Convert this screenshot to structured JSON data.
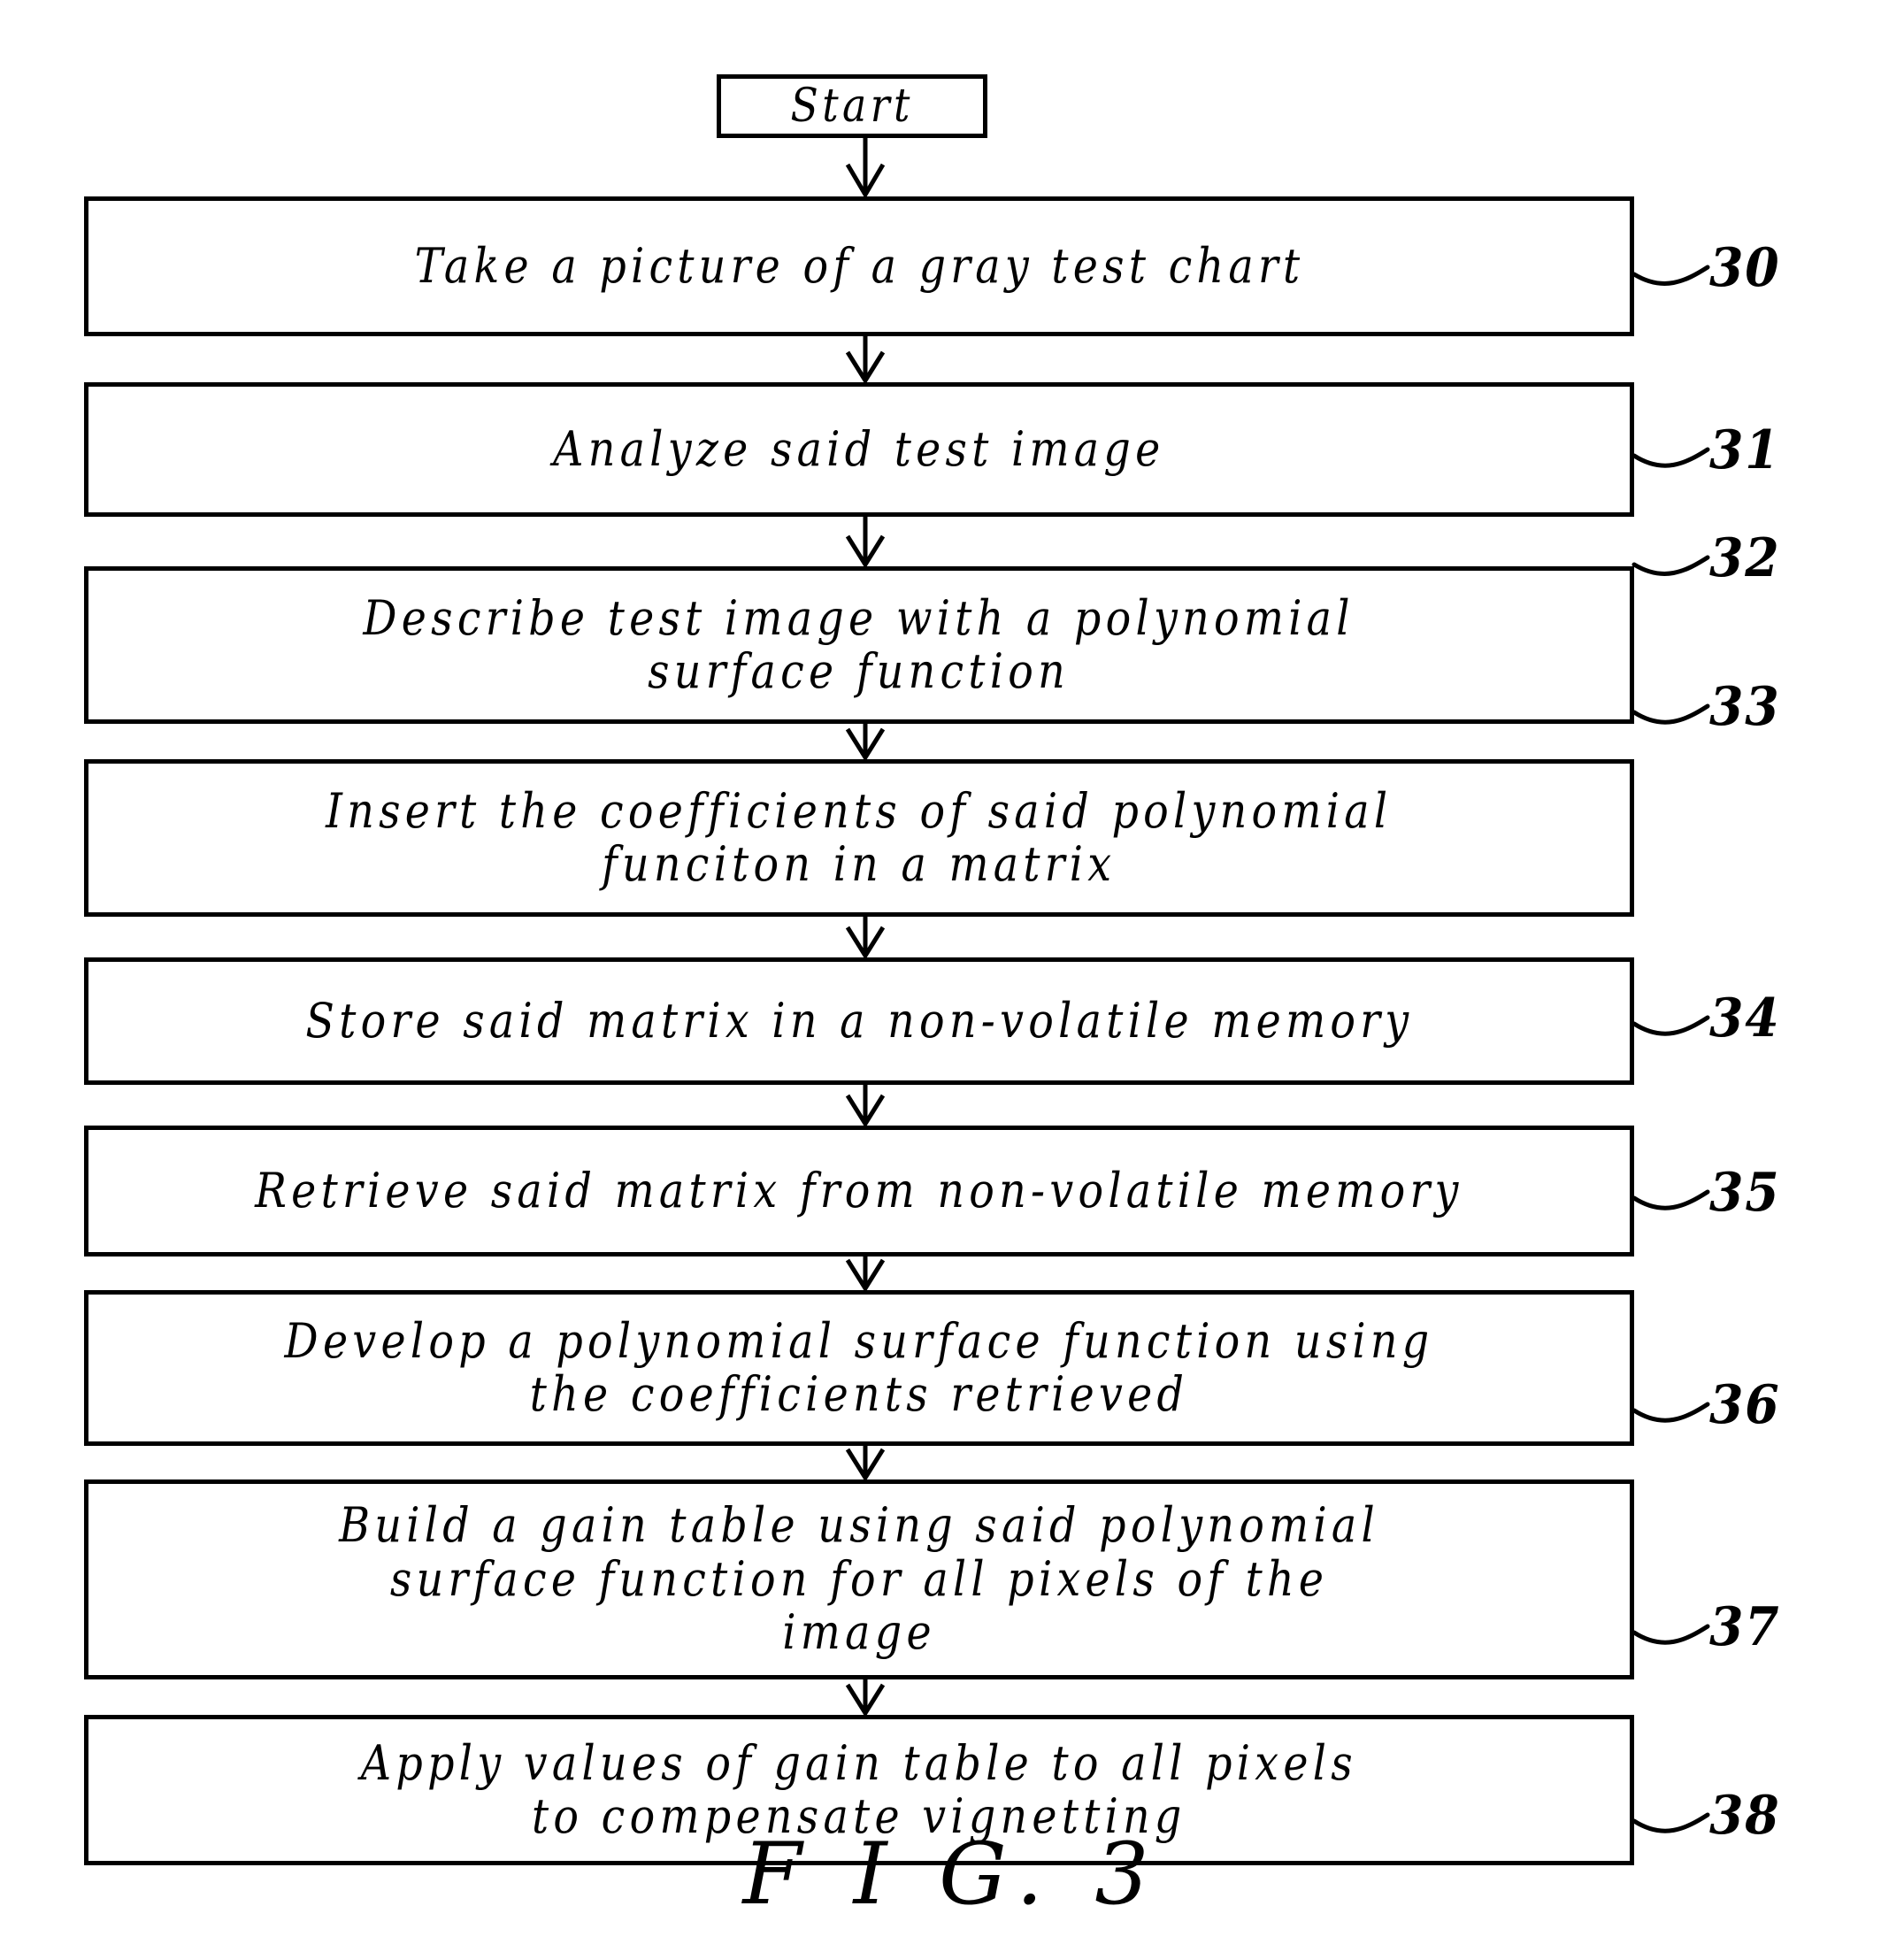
{
  "figure": {
    "caption": "F I G.   3",
    "title": "Flowchart of vignetting compensation method"
  },
  "flowchart": {
    "start": {
      "label": "Start",
      "ref": ""
    },
    "steps": [
      {
        "ref": "30",
        "text": "Take a picture of a gray test chart",
        "lines": 1
      },
      {
        "ref": "31",
        "text": "Analyze said test image",
        "lines": 1
      },
      {
        "ref": "32",
        "text": "Describe test image with a polynomial\nsurface function",
        "lines": 2
      },
      {
        "ref": "33",
        "text": "Insert the coefficients of said polynomial\nfunciton in a matrix",
        "lines": 2
      },
      {
        "ref": "34",
        "text": "Store said matrix in a non-volatile memory",
        "lines": 1
      },
      {
        "ref": "35",
        "text": "Retrieve said matrix from non-volatile memory",
        "lines": 1
      },
      {
        "ref": "36",
        "text": "Develop a polynomial surface function using\nthe coefficients retrieved",
        "lines": 2
      },
      {
        "ref": "37",
        "text": "Build a gain table using said polynomial\nsurface function for all pixels of the\nimage",
        "lines": 3
      },
      {
        "ref": "38",
        "text": "Apply values of gain table to all pixels\nto compensate vignetting",
        "lines": 2
      }
    ]
  },
  "colors": {
    "ink": "#000000",
    "paper": "#ffffff"
  }
}
